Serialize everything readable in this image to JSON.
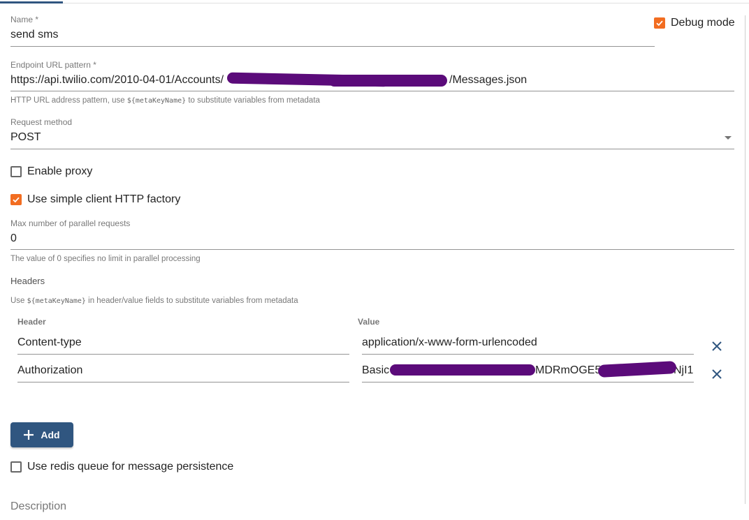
{
  "debug": {
    "label": "Debug mode",
    "checked": true
  },
  "name": {
    "label": "Name *",
    "value": "send sms"
  },
  "endpoint": {
    "label": "Endpoint URL pattern *",
    "value_prefix": "https://api.twilio.com/2010-04-01/Accounts/",
    "value_suffix": "/Messages.json",
    "hint_prefix": "HTTP URL address pattern, use",
    "hint_code": "${metaKeyName}",
    "hint_suffix": "to substitute variables from metadata"
  },
  "request_method": {
    "label": "Request method",
    "value": "POST"
  },
  "enable_proxy": {
    "label": "Enable proxy",
    "checked": false
  },
  "simple_client": {
    "label": "Use simple client HTTP factory",
    "checked": true
  },
  "max_parallel": {
    "label": "Max number of parallel requests",
    "value": "0",
    "hint": "The value of 0 specifies no limit in parallel processing"
  },
  "headers": {
    "title": "Headers",
    "hint_prefix": "Use",
    "hint_code": "${metaKeyName}",
    "hint_suffix": "in header/value fields to substitute variables from metadata",
    "col_header": "Header",
    "col_value": "Value",
    "rows": [
      {
        "header": "Content-type",
        "value": "application/x-www-form-urlencoded"
      },
      {
        "header": "Authorization",
        "value_start": "Basic",
        "value_mid": "MDRmOGE5Y",
        "value_end": "NjI1"
      }
    ],
    "add_label": "Add"
  },
  "redis": {
    "label": "Use redis queue for message persistence",
    "checked": false
  },
  "description": {
    "label": "Description"
  },
  "colors": {
    "accent": "#f26d21",
    "primary": "#305680",
    "redaction": "#5b0b7a"
  }
}
